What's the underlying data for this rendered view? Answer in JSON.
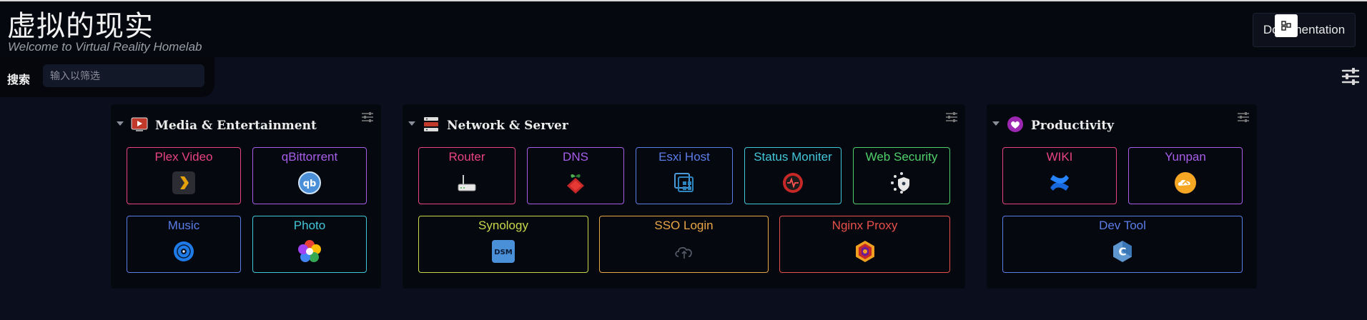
{
  "header": {
    "title": "虚拟的现实",
    "subtitle": "Welcome to Virtual Reality Homelab",
    "doc_button": "Documentation"
  },
  "search": {
    "label": "搜索",
    "placeholder": "输入以筛选"
  },
  "sections": [
    {
      "title": "Media & Entertainment",
      "icon": "tv-icon",
      "items": [
        {
          "label": "Plex Video",
          "color": "#e8447f",
          "icon": "plex-icon"
        },
        {
          "label": "qBittorrent",
          "color": "#a65ee8",
          "icon": "qbittorrent-icon"
        },
        {
          "label": "Music",
          "color": "#5b7de8",
          "icon": "music-disc-icon"
        },
        {
          "label": "Photo",
          "color": "#43c6d8",
          "icon": "photo-flower-icon"
        }
      ]
    },
    {
      "title": "Network & Server",
      "icon": "server-rack-icon",
      "items": [
        {
          "label": "Router",
          "color": "#e8447f",
          "icon": "router-icon"
        },
        {
          "label": "DNS",
          "color": "#a65ee8",
          "icon": "pihole-icon"
        },
        {
          "label": "Esxi Host",
          "color": "#5b7de8",
          "icon": "esxi-icon"
        },
        {
          "label": "Status Moniter",
          "color": "#43c6d8",
          "icon": "uptime-monitor-icon"
        },
        {
          "label": "Web Security",
          "color": "#4fd06a",
          "icon": "shield-icon"
        },
        {
          "label": "Synology",
          "color": "#c8d84a",
          "icon": "dsm-icon"
        },
        {
          "label": "SSO Login",
          "color": "#e8a645",
          "icon": "cloud-sync-icon"
        },
        {
          "label": "Nginx Proxy",
          "color": "#e8504a",
          "icon": "nginx-proxy-icon"
        }
      ]
    },
    {
      "title": "Productivity",
      "icon": "heart-icon",
      "items": [
        {
          "label": "WIKI",
          "color": "#e8447f",
          "icon": "confluence-icon"
        },
        {
          "label": "Yunpan",
          "color": "#a65ee8",
          "icon": "cloud-drive-icon"
        },
        {
          "label": "Dev Tool",
          "color": "#5b7de8",
          "icon": "code-c-icon"
        }
      ]
    }
  ]
}
